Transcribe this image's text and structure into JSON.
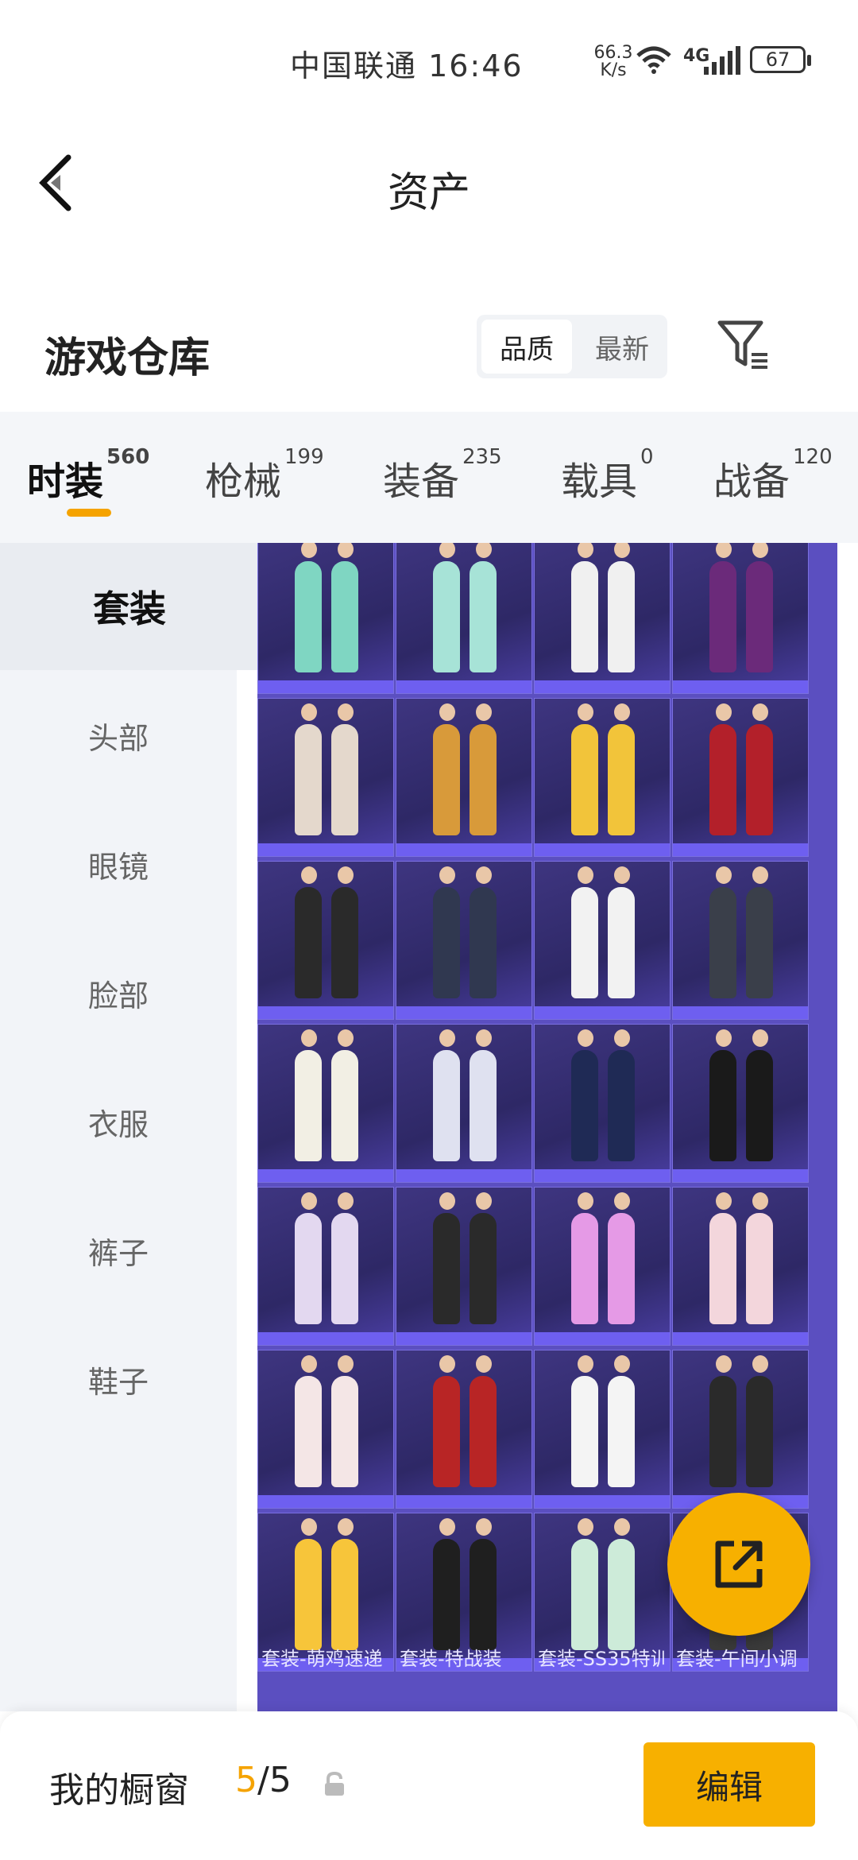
{
  "status": {
    "carrier_time": "中国联通 16:46",
    "net_speed": "66.3",
    "net_unit": "K/s",
    "network": "4G",
    "battery": "67"
  },
  "header": {
    "title": "资产"
  },
  "warehouse": {
    "title": "游戏仓库",
    "sort_options": [
      "品质",
      "最新"
    ],
    "active_sort": "品质",
    "filter_icon": "filter-icon"
  },
  "tabs": [
    {
      "label": "时装",
      "count": "560"
    },
    {
      "label": "枪械",
      "count": "199"
    },
    {
      "label": "装备",
      "count": "235"
    },
    {
      "label": "载具",
      "count": "0"
    },
    {
      "label": "战备",
      "count": "120"
    }
  ],
  "sidebar": {
    "items": [
      "套装",
      "头部",
      "眼镜",
      "脸部",
      "衣服",
      "裤子",
      "鞋子"
    ]
  },
  "grid": {
    "bottom_labels": [
      "套装-萌鸡速递",
      "套装-特战装",
      "套装-SS35特训",
      "套装-午间小调"
    ],
    "item_colors": [
      [
        "#7fd6c2",
        "#a7e3d7",
        "#f0f0f0",
        "#6b2a7a"
      ],
      [
        "#e4d8cc",
        "#d89a3a",
        "#f2c43a",
        "#b3202a"
      ],
      [
        "#2a2a2a",
        "#303850",
        "#f2f2f2",
        "#3a3f4a"
      ],
      [
        "#f2efe4",
        "#dfe1f0",
        "#1f2a55",
        "#1a1a1a"
      ],
      [
        "#e3d8f0",
        "#2a2a2a",
        "#e59ae6",
        "#f3d6dc"
      ],
      [
        "#f4e6e6",
        "#b82525",
        "#f4f4f4",
        "#2a2a2a"
      ],
      [
        "#f7c53a",
        "#1f1f1f",
        "#cdebd9",
        "#3a3a3a"
      ]
    ]
  },
  "fab": {
    "icon": "share-icon"
  },
  "bottom": {
    "label": "我的橱窗",
    "used": "5",
    "total": "/5",
    "lock_icon": "lock-icon",
    "edit_label": "编辑"
  },
  "accent_color": "#f7b000"
}
